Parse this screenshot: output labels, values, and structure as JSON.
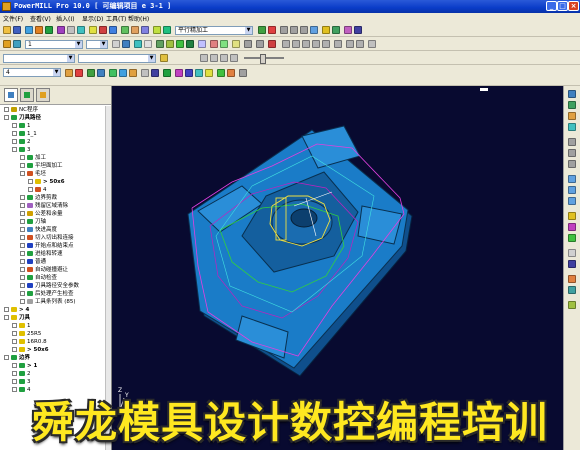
{
  "window": {
    "title": "PowerMILL Pro 10.0   [ 可编辑项目 e 3-1 ]",
    "minimize": "_",
    "maximize": "□",
    "close": "×"
  },
  "menu": [
    "文件(F)",
    "查看(V)",
    "插入(I)",
    "显示(D)",
    "工具(T)",
    "帮助(H)"
  ],
  "toolbar": {
    "strategy_combo": "平行精加工",
    "tool_combo": "1",
    "level_combo": "4"
  },
  "explorer": {
    "nodes": [
      {
        "label": "NC程序",
        "depth": 0,
        "color": "#c0a000"
      },
      {
        "label": "刀具路径",
        "depth": 0,
        "color": "#20a040",
        "bold": true
      },
      {
        "label": "1",
        "depth": 1,
        "color": "#20a040"
      },
      {
        "label": "1_1",
        "depth": 1,
        "color": "#20a040"
      },
      {
        "label": "2",
        "depth": 1,
        "color": "#20a040"
      },
      {
        "label": "3",
        "depth": 1,
        "color": "#20a040"
      },
      {
        "label": "加工",
        "depth": 2,
        "color": "#20a040"
      },
      {
        "label": "平坦面加工",
        "depth": 2,
        "color": "#20a040"
      },
      {
        "label": "毛坯",
        "depth": 2,
        "color": "#d05020"
      },
      {
        "label": "> 50x6",
        "depth": 3,
        "color": "#e0c000",
        "bold": true
      },
      {
        "label": "4",
        "depth": 3,
        "color": "#d05020"
      },
      {
        "label": "边界剪裁",
        "depth": 2,
        "color": "#20a040"
      },
      {
        "label": "残留区域清除",
        "depth": 2,
        "color": "#a060c0"
      },
      {
        "label": "公差和余量",
        "depth": 2,
        "color": "#d0a000"
      },
      {
        "label": "刀轴",
        "depth": 2,
        "color": "#20a040"
      },
      {
        "label": "快进高度",
        "depth": 2,
        "color": "#4080c0"
      },
      {
        "label": "切入切出和连接",
        "depth": 2,
        "color": "#d05020"
      },
      {
        "label": "开始点和结束点",
        "depth": 2,
        "color": "#2040c0"
      },
      {
        "label": "进给和转速",
        "depth": 2,
        "color": "#20a040"
      },
      {
        "label": "普通",
        "depth": 2,
        "color": "#2040c0"
      },
      {
        "label": "自动碰撞避让",
        "depth": 2,
        "color": "#d05020"
      },
      {
        "label": "自动检查",
        "depth": 2,
        "color": "#20a040"
      },
      {
        "label": "刀具路径安全参数",
        "depth": 2,
        "color": "#2040c0"
      },
      {
        "label": "后处理产生检查",
        "depth": 2,
        "color": "#20a040"
      },
      {
        "label": "工具条列表 (85)",
        "depth": 2,
        "color": "#a0a0a0"
      },
      {
        "label": "> 4",
        "depth": 0,
        "color": "#e0c000",
        "bold": true
      },
      {
        "label": "刀具",
        "depth": 0,
        "color": "#e0c000",
        "bold": true
      },
      {
        "label": "1",
        "depth": 1,
        "color": "#e0c000"
      },
      {
        "label": "25R5",
        "depth": 1,
        "color": "#e0c000"
      },
      {
        "label": "16R0.8",
        "depth": 1,
        "color": "#e0c000"
      },
      {
        "label": "> 50x6",
        "depth": 1,
        "color": "#e0c000",
        "bold": true
      },
      {
        "label": "边界",
        "depth": 0,
        "color": "#20a040",
        "bold": true
      },
      {
        "label": "> 1",
        "depth": 1,
        "color": "#20a040",
        "bold": true
      },
      {
        "label": "2",
        "depth": 1,
        "color": "#20a040"
      },
      {
        "label": "3",
        "depth": 1,
        "color": "#20a040"
      },
      {
        "label": "4",
        "depth": 1,
        "color": "#20a040"
      }
    ]
  },
  "viewport": {
    "axis_x": "X",
    "axis_y": "Y",
    "axis_z": "Z",
    "background": "#080a30",
    "part_color": "#1a7cc8"
  },
  "watermark": "舜龙模具设计数控编程培训"
}
